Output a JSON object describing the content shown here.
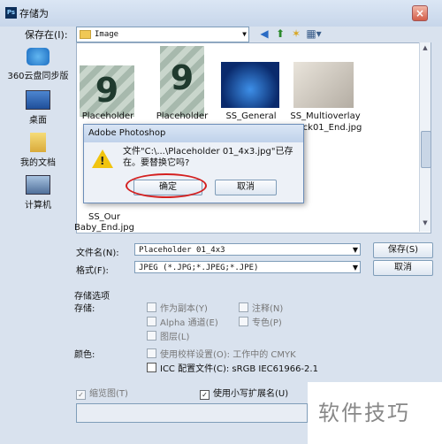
{
  "window": {
    "title": "存储为",
    "app_icon": "Ps"
  },
  "top": {
    "save_in_label": "保存在(I):",
    "folder_name": "Image"
  },
  "places": [
    {
      "label": "360云盘同步版",
      "icon": "cloud-icon"
    },
    {
      "label": "桌面",
      "icon": "desktop-icon"
    },
    {
      "label": "我的文档",
      "icon": "documents-icon"
    },
    {
      "label": "计算机",
      "icon": "computer-icon"
    }
  ],
  "files": [
    {
      "name_line1": "Placeholder",
      "thumb_text": "9"
    },
    {
      "name_line1": "Placeholder",
      "thumb_text": "9"
    },
    {
      "name_line1": "SS_General"
    },
    {
      "name_line1": "SS_Multioverlay",
      "name_line2": "ck01_End.jpg"
    },
    {
      "name_line1": "SS_Our",
      "name_line2": "Baby_End.jpg"
    }
  ],
  "dialog": {
    "title": "Adobe Photoshop",
    "message": "文件\"C:\\...\\Placeholder 01_4x3.jpg\"已存在。要替换它吗?",
    "ok_label": "确定",
    "cancel_label": "取消"
  },
  "form": {
    "filename_label": "文件名(N):",
    "filename_value": "Placeholder 01_4x3",
    "format_label": "格式(F):",
    "format_value": "JPEG (*.JPG;*.JPEG;*.JPE)",
    "save_button": "保存(S)",
    "cancel_button": "取消"
  },
  "options": {
    "section_title": "存储选项",
    "storage_label": "存储:",
    "as_copy": "作为副本(Y)",
    "notes": "注释(N)",
    "alpha": "Alpha 通道(E)",
    "spot": "专色(P)",
    "layers": "图层(L)",
    "color_label": "颜色:",
    "proof": "使用校样设置(O): 工作中的 CMYK",
    "icc": "ICC 配置文件(C): sRGB IEC61966-2.1",
    "thumbnail": "缩览图(T)",
    "lowercase_ext": "使用小写扩展名(U)",
    "check_mark": "✓"
  },
  "watermark": {
    "text": "软件技巧"
  },
  "colors": {
    "highlight_ring": "#d42020",
    "title_gradient": "#c7d6ea"
  }
}
